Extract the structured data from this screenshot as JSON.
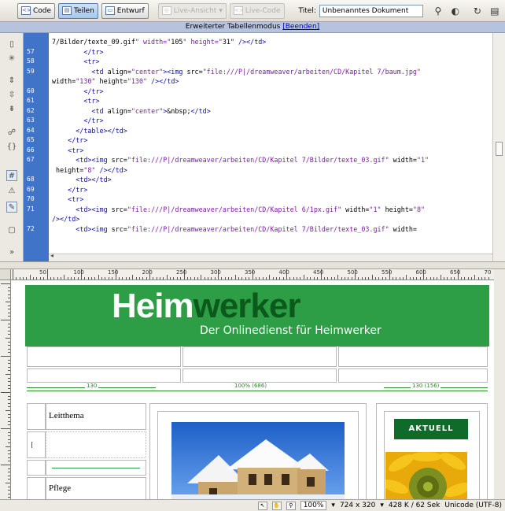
{
  "toolbar": {
    "code_label": "Code",
    "split_label": "Teilen",
    "design_label": "Entwurf",
    "live_view_label": "Live-Ansicht",
    "live_code_label": "Live-Code",
    "title_label": "Titel:",
    "title_value": "Unbenanntes Dokument"
  },
  "banner": {
    "text": "Erweiterter Tabellenmodus",
    "exit_link": "[Beenden]"
  },
  "code": {
    "lines": [
      {
        "no": "",
        "text": "7/Bilder/texte_09.gif\" width=\"105\" height=\"31\" /></td>"
      },
      {
        "no": "57",
        "text": "        </tr>"
      },
      {
        "no": "58",
        "text": "        <tr>"
      },
      {
        "no": "59",
        "text": "          <td align=\"center\"><img src=\"file:///P|/dreamweaver/arbeiten/CD/Kapitel 7/baum.jpg\""
      },
      {
        "no": "",
        "text": "width=\"130\" height=\"130\" /></td>"
      },
      {
        "no": "60",
        "text": "        </tr>"
      },
      {
        "no": "61",
        "text": "        <tr>"
      },
      {
        "no": "62",
        "text": "          <td align=\"center\">&nbsp;</td>"
      },
      {
        "no": "63",
        "text": "        </tr>"
      },
      {
        "no": "64",
        "text": "      </table></td>"
      },
      {
        "no": "65",
        "text": "    </tr>"
      },
      {
        "no": "66",
        "text": "    <tr>"
      },
      {
        "no": "67",
        "text": "      <td><img src=\"file:///P|/dreamweaver/arbeiten/CD/Kapitel 7/Bilder/texte_03.gif\" width=\"1\""
      },
      {
        "no": "",
        "text": " height=\"8\" /></td>"
      },
      {
        "no": "68",
        "text": "      <td></td>"
      },
      {
        "no": "69",
        "text": "    </tr>"
      },
      {
        "no": "70",
        "text": "    <tr>"
      },
      {
        "no": "71",
        "text": "      <td><img src=\"file:///P|/dreamweaver/arbeiten/CD/Kapitel 6/1px.gif\" width=\"1\" height=\"8\""
      },
      {
        "no": "",
        "text": "/></td>"
      },
      {
        "no": "72",
        "text": "      <td><img src=\"file:///P|/dreamweaver/arbeiten/CD/Kapitel 7/Bilder/texte_03.gif\" width="
      }
    ]
  },
  "ruler": {
    "labels": [
      "50",
      "100",
      "150",
      "200",
      "250",
      "300",
      "350",
      "400",
      "450",
      "500",
      "550",
      "600",
      "650",
      "70"
    ]
  },
  "design": {
    "logo_part1": "Heim",
    "logo_part2": "werker",
    "tagline": "Der Onlinedienst für Heimwerker",
    "dim_left": "130",
    "dim_center": "100% (686)",
    "dim_right": "130 (156)",
    "leitthema": "Leitthema",
    "pflege": "Pflege",
    "aktuell": "AKTUELL",
    "colors": {
      "header_green": "#2e9e46",
      "logo_dark": "#0c5a1b",
      "aktuell_bg": "#0e6b2a"
    }
  },
  "status": {
    "zoom": "100%",
    "dimensions": "724 x 320",
    "size": "428 K / 62 Sek",
    "encoding": "Unicode (UTF-8)"
  }
}
